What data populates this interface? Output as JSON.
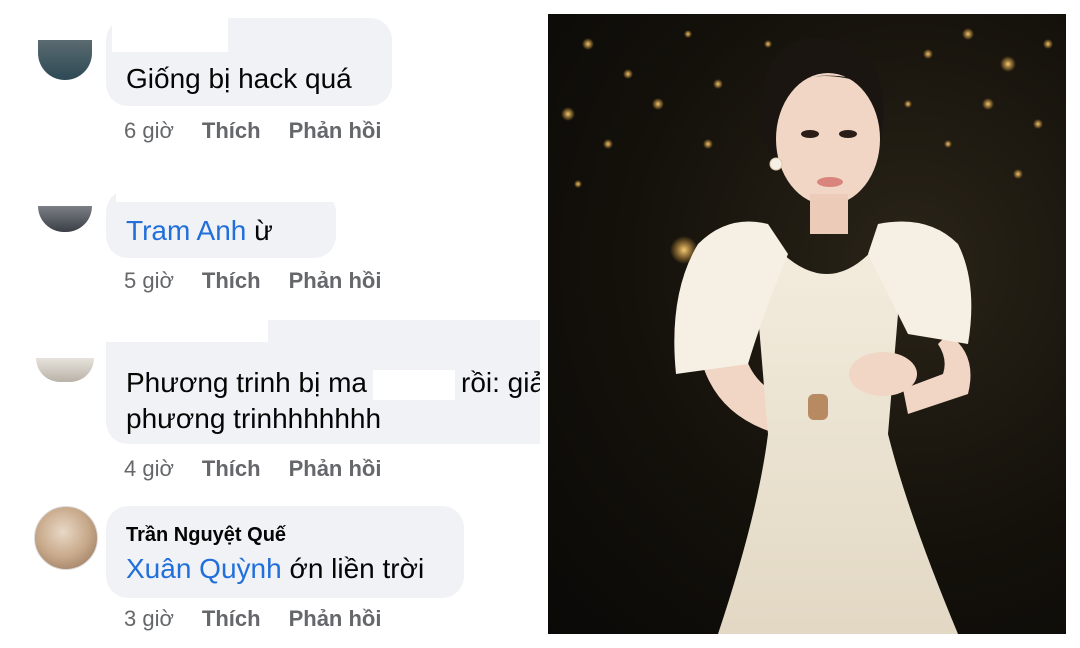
{
  "comments": [
    {
      "author": "",
      "mention": "",
      "text": "Giống bị hack quá",
      "time": "6 giờ",
      "like": "Thích",
      "reply": "Phản hồi"
    },
    {
      "author": "",
      "mention": "Tram Anh",
      "text": " ừ",
      "time": "5 giờ",
      "like": "Thích",
      "reply": "Phản hồi"
    },
    {
      "author": "",
      "mention": "",
      "text_line1_a": "Phương trinh bị ma",
      "text_line1_b": "rồi: giả",
      "text_line2": "phương trinhhhhhhh",
      "time": "4 giờ",
      "like": "Thích",
      "reply": "Phản hồi"
    },
    {
      "author": "Trần Nguyệt Quế",
      "mention": "Xuân Quỳnh",
      "text": " ớn liền trời",
      "time": "3 giờ",
      "like": "Thích",
      "reply": "Phản hồi"
    }
  ],
  "photo": {
    "description_icon": "portrait-photo"
  },
  "colors": {
    "bubble": "#f0f2f5",
    "mention": "#216fdb",
    "meta": "#65676b"
  }
}
